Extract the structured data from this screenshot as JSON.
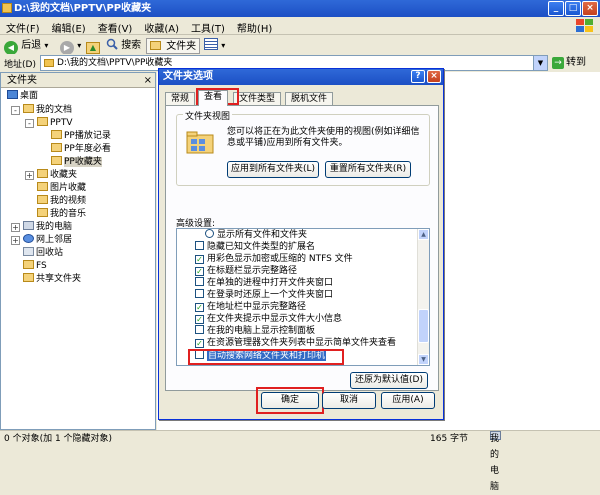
{
  "window": {
    "title": "D:\\我的文档\\PPTV\\PP收藏夹",
    "buttons": [
      "_",
      "□",
      "×"
    ]
  },
  "menu": [
    "文件(F)",
    "编辑(E)",
    "查看(V)",
    "收藏(A)",
    "工具(T)",
    "帮助(H)"
  ],
  "toolbar": {
    "back": "后退",
    "back_arrow": "◀",
    "forward_arrow": "▶",
    "up_arrow": "▲",
    "dropdown": "▾",
    "search": "搜索",
    "folders": "文件夹"
  },
  "address": {
    "label": "地址(D)",
    "value": "D:\\我的文档\\PPTV\\PP收藏夹",
    "dropdown": "▼",
    "go": "转到"
  },
  "sidebar": {
    "title": "文件夹",
    "close": "×",
    "tree": [
      {
        "label": "桌面"
      },
      {
        "label": "我的文档",
        "expander": "-"
      },
      {
        "label": "PPTV",
        "expander": "-"
      },
      {
        "label": "PP播放记录"
      },
      {
        "label": "PP年度必看"
      },
      {
        "label": "PP收藏夹"
      },
      {
        "label": "收藏夹",
        "expander": "+"
      },
      {
        "label": "图片收藏"
      },
      {
        "label": "我的视频"
      },
      {
        "label": "我的音乐"
      },
      {
        "label": "我的电脑",
        "expander": "+"
      },
      {
        "label": "网上邻居",
        "expander": "+"
      },
      {
        "label": "回收站"
      },
      {
        "label": "FS"
      },
      {
        "label": "共享文件夹"
      }
    ]
  },
  "dialog": {
    "title": "文件夹选项",
    "help": "?",
    "close": "×",
    "tabs": [
      "常规",
      "查看",
      "文件类型",
      "脱机文件"
    ],
    "active_tab": "查看",
    "group": {
      "label": "文件夹视图",
      "description": "您可以将正在为此文件夹使用的视图(例如详细信息或平铺)应用到所有文件夹。",
      "apply_all": "应用到所有文件夹(L)",
      "reset_all": "重置所有文件夹(R)"
    },
    "advanced_label": "高级设置:",
    "checkmark": "✓",
    "advanced_items": [
      {
        "label": "显示所有文件和文件夹",
        "type": "radio",
        "checked": false
      },
      {
        "label": "隐藏已知文件类型的扩展名",
        "type": "checkbox",
        "checked": false
      },
      {
        "label": "用彩色显示加密或压缩的 NTFS 文件",
        "type": "checkbox",
        "checked": true
      },
      {
        "label": "在标题栏显示完整路径",
        "type": "checkbox",
        "checked": true
      },
      {
        "label": "在单独的进程中打开文件夹窗口",
        "type": "checkbox",
        "checked": false
      },
      {
        "label": "在登录时还原上一个文件夹窗口",
        "type": "checkbox",
        "checked": false
      },
      {
        "label": "在地址栏中显示完整路径",
        "type": "checkbox",
        "checked": true
      },
      {
        "label": "在文件夹提示中显示文件大小信息",
        "type": "checkbox",
        "checked": true
      },
      {
        "label": "在我的电脑上显示控制面板",
        "type": "checkbox",
        "checked": false
      },
      {
        "label": "在资源管理器文件夹列表中显示简单文件夹查看",
        "type": "checkbox",
        "checked": true
      },
      {
        "label": "自动搜索网络文件夹和打印机",
        "type": "checkbox",
        "checked": false,
        "highlighted": true
      }
    ],
    "restore_defaults": "还原为默认值(D)",
    "ok": "确定",
    "cancel": "取消",
    "apply": "应用(A)"
  },
  "status": {
    "left": "0 个对象(加 1 个隐藏对象)",
    "size": "165 字节",
    "location": "我的电脑"
  },
  "colors": {
    "accent": "#316ac5",
    "highlight_box": "#e02020"
  }
}
